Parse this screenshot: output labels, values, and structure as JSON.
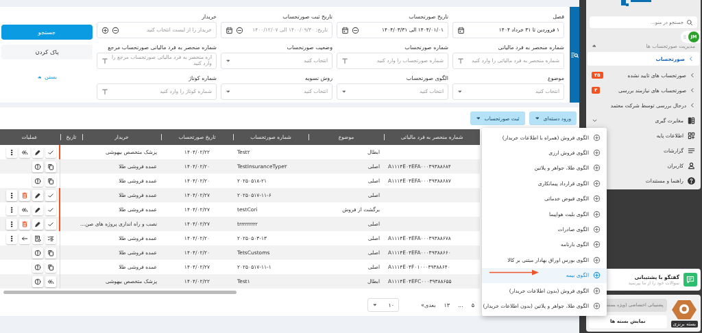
{
  "filters": {
    "fields": [
      {
        "label": "فصل",
        "kind": "calendar",
        "value": "۱ فروردین تا ۳۱ خرداد ۱۴۰۴"
      },
      {
        "label": "تاریخ صورتحساب",
        "kind": "date-range",
        "value": "۱۴۰۴/۰۱/۰۱ الی ۱۴۰۴/۰۳/۳۱"
      },
      {
        "label": "تاریخ ثبت صورتحساب",
        "kind": "date-range",
        "placeholder": "تاریخ: ۱۴۰۰/۰۹/۳۰ الی ۱۴۰۰/۱۲/۰۷"
      },
      {
        "label": "خریدار",
        "kind": "lookup",
        "placeholder": "خریدار را از لیست انتخاب کنید"
      },
      {
        "label": "شماره منحصر به فرد مالیاتی",
        "kind": "text",
        "placeholder": "شماره منحصر به فرد مالیاتی را وارد کنید"
      },
      {
        "label": "شماره صورتحساب",
        "kind": "text",
        "placeholder": "شماره صورتحساب را وارد کنید"
      },
      {
        "label": "وضعیت صورتحساب",
        "kind": "select",
        "placeholder": "انتخاب کنید"
      },
      {
        "label": "شماره منحصر به فرد مالیاتی صورتحساب مرجع",
        "kind": "text",
        "placeholder": "اره منحصر به فرد مالیاتی صورتحساب مرجع را وارد کنید"
      },
      {
        "label": "موضوع",
        "kind": "select",
        "placeholder": "انتخاب کنید"
      },
      {
        "label": "الگوی صورتحساب",
        "kind": "select",
        "placeholder": "انتخاب کنید"
      },
      {
        "label": "روش تسویه",
        "kind": "select",
        "placeholder": "انتخاب کنید"
      },
      {
        "label": "شماره کوتاژ",
        "kind": "text",
        "placeholder": "شماره کوتاژ را وارد کنید"
      }
    ],
    "search_button": "جستجو",
    "clear_button": "پاک کردن",
    "collapse_link": "بستن"
  },
  "toolbar": [
    "ورود دسته‌ای",
    "ثبت صورتحساب"
  ],
  "table": {
    "columns": [
      "شماره منحصر به فرد مالیاتی",
      "موضوع",
      "شماره صورتحساب",
      "تاریخ صورتحساب",
      "خریدار",
      "تاریخ",
      "عملیات"
    ],
    "rows": [
      {
        "subject": "ابطال",
        "number": "Test۲",
        "date": "۱۴۰۴/۰۲/۲۲",
        "buyer": "پزشک متخصص بیهوشی",
        "flagged": true,
        "actions": [
          {
            "kind": "check"
          },
          {
            "kind": "edit"
          },
          {
            "kind": "reply_all"
          },
          {
            "kind": "more"
          }
        ]
      },
      {
        "tax_id": "A۱۱۱۴E۰۴EFA۰۰۰۳۹۳۸۸۶۸۴",
        "subject": "اصلی",
        "number": "TestInsuranceType۲",
        "date": "۱۴۰۴/۰۲/۲۰",
        "buyer": "عمده فروشی طلا",
        "flagged": false,
        "actions": [
          {
            "kind": "copy"
          },
          {
            "kind": "info"
          }
        ]
      },
      {
        "tax_id": "A۱۱۱۴E۰۴EFA۰۰۰۳۹۳۸۸۶۸۷",
        "subject": "اصلی",
        "number": "۲۰۲۵۰۵۱۸-۲۱",
        "date": "۱۴۰۴/۰۲/۲۰",
        "buyer": "عمده فروشی طلا",
        "flagged": false,
        "actions": [
          {
            "kind": "copy"
          },
          {
            "kind": "info"
          }
        ]
      },
      {
        "subject": "اصلی",
        "number": "۲۰۲۵۰۵۱۷-۱۱-۶",
        "date": "۱۴۰۴/۰۲/۲۷",
        "buyer": "عمده فروشی طلا",
        "flagged": true,
        "actions": [
          {
            "kind": "check"
          },
          {
            "kind": "edit"
          },
          {
            "kind": "delete"
          },
          {
            "kind": "more"
          }
        ]
      },
      {
        "subject": "برگشت از فروش",
        "number": "testCori",
        "date": "۱۴۰۴/۰۲/۲۷",
        "buyer": "عمده فروشی طلا",
        "flagged": true,
        "actions": [
          {
            "kind": "check"
          },
          {
            "kind": "edit"
          },
          {
            "kind": "reply_all"
          },
          {
            "kind": "more"
          }
        ]
      },
      {
        "subject": "اصلی",
        "number": "trrrrrrrrr",
        "date": "۱۴۰۴/۰۲/۲۷",
        "buyer": "نصب و راه اندازی پروژه های صن...",
        "flagged": true,
        "actions": [
          {
            "kind": "check"
          },
          {
            "kind": "edit"
          },
          {
            "kind": "delete"
          },
          {
            "kind": "more"
          }
        ]
      },
      {
        "tax_id": "A۱۱۱۴E۰۴EFA۰۰۰۳۹۳۸۸۶۷۸",
        "subject": "اصلی",
        "number": "۲۰۲۵۰۵۰۳-۱۳",
        "date": "۱۴۰۴/۰۲/۲۰",
        "buyer": "عمده فروشی طلا",
        "flagged": false,
        "actions": [
          {
            "kind": "checklist"
          },
          {
            "kind": "invoice"
          },
          {
            "kind": "return"
          },
          {
            "kind": "more"
          }
        ]
      },
      {
        "tax_id": "A۱۱۱۴E۰۴EFA۰۰۰۳۹۳۸۸۶۶۰",
        "subject": "اصلی",
        "number": "TetsCustoms",
        "date": "۱۴۰۴/۰۲/۲۰",
        "buyer": "عمده فروشی طلا",
        "flagged": false,
        "actions": [
          {
            "kind": "copy"
          },
          {
            "kind": "info"
          }
        ]
      },
      {
        "tax_id": "A۱۱۱۴E۰۴F۰۱۰۰۰۳۹۳۸۸۶۴۰",
        "subject": "اصلی",
        "number": "۲۰۲۵۰۵۱۷-۱۱-۱",
        "date": "۱۴۰۴/۰۲/۲۷",
        "buyer": "عمده فروشی طلا",
        "flagged": false,
        "actions": [
          {
            "kind": "copy"
          },
          {
            "kind": "info"
          }
        ]
      },
      {
        "tax_id": "A۱۱۱۴E۰۴EFC۰۰۰۳۹۳۸۸۶۵۵",
        "subject": "ابطال",
        "number": "Test۱",
        "date": "۱۴۰۴/۰۲/۲۲",
        "buyer": "پزشک متخصص بیهوشی",
        "flagged": false,
        "actions": [
          {
            "kind": "reply_all"
          },
          {
            "kind": "info"
          }
        ]
      }
    ]
  },
  "pagination": {
    "pages": [
      "۵",
      "...",
      "۱۳"
    ],
    "next": "بعدی»",
    "page_size": "۱۰"
  },
  "dropdown": {
    "items": [
      {
        "label": "الگوی فروش (همراه با اطلاعات خریدار)",
        "selected": false
      },
      {
        "label": "الگوی فروش ارزی",
        "selected": false
      },
      {
        "label": "الگوی طلا، جواهر و پلاتین",
        "selected": false
      },
      {
        "label": "الگوی قرارداد پیمانکاری",
        "selected": false
      },
      {
        "label": "الگوی قبوض خدماتی",
        "selected": false
      },
      {
        "label": "الگوی بلیت هواپیما",
        "selected": false
      },
      {
        "label": "الگوی صادرات",
        "selected": false
      },
      {
        "label": "الگوی بارنامه",
        "selected": false
      },
      {
        "label": "الگوی بورس اوراق بهادار مبتنی بر کالا",
        "selected": false
      },
      {
        "label": "الگوی بیمه",
        "selected": true
      },
      {
        "label": "الگوی فروش (بدون اطلاعات خریدار)",
        "selected": false
      },
      {
        "label": "الگوی طلا، جواهر و پلاتین (بدون اطلاعات خریدار)",
        "selected": false
      }
    ]
  },
  "sidebar": {
    "search": {
      "placeholder": "جستجو در منو..."
    },
    "avatar": "JM",
    "section": {
      "label": "مدیریت صورتحساب ها",
      "expanded": true,
      "items": [
        {
          "label": "صورتحساب",
          "selected": true
        },
        {
          "label": "صورتحساب های تایید نشده",
          "selected": false,
          "badge": "۲۵"
        },
        {
          "label": "صورتحساب های نیازمند بررسی",
          "selected": false,
          "badge": "۳"
        },
        {
          "label": "درحال بررسی توسط شرکت معتمد",
          "selected": false
        }
      ]
    },
    "menu": [
      {
        "label": "مغایرت گیری",
        "kind": "group"
      },
      {
        "label": "اطلاعات پایه",
        "kind": "link"
      },
      {
        "label": "گزارشات",
        "kind": "link"
      },
      {
        "label": "کاربران",
        "kind": "link"
      },
      {
        "label": "راهنما و مستندات",
        "kind": "link"
      }
    ],
    "chat": {
      "title": "گفتگو با پشتیبانی",
      "subtitle": "سوالات خود را از ما بپرسید"
    },
    "package": {
      "support_button": "پشتیبانی اختصاصی (ویژه بسته",
      "support_disabled": true,
      "show_button": "نمایش بسته ها",
      "badge": "بسته برنزی"
    }
  }
}
